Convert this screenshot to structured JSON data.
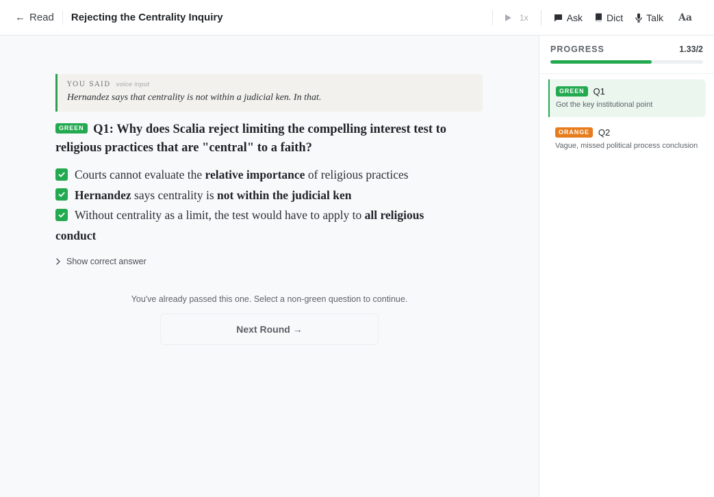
{
  "header": {
    "back_label": "Read",
    "title": "Rejecting the Centrality Inquiry",
    "speed_label": "1x",
    "tools": {
      "ask": "Ask",
      "dict": "Dict",
      "talk": "Talk",
      "font": "Aa"
    }
  },
  "transcript": {
    "label": "YOU SAID",
    "tag": "voice input",
    "text": "Hernandez says that centrality is not within a judicial ken. In that."
  },
  "question": {
    "badge": "GREEN",
    "text": "Q1: Why does Scalia reject limiting the compelling interest test to religious practices that are \"central\" to a faith?"
  },
  "criteria": [
    {
      "pre": "Courts cannot evaluate the ",
      "bold": "relative importance",
      "post": " of religious practices",
      "lead_bold": ""
    },
    {
      "lead_bold": "Hernandez",
      "pre": " says centrality is ",
      "bold": "not within the judicial ken",
      "post": ""
    },
    {
      "lead_bold": "",
      "pre": "Without centrality as a limit, the test would have to apply to ",
      "bold": "all religious conduct",
      "post": ""
    }
  ],
  "show_answer_label": "Show correct answer",
  "passed_message": "You've already passed this one. Select a non-green question to continue.",
  "next_button_label": "Next Round →",
  "sidebar": {
    "progress_label": "PROGRESS",
    "progress_value_text": "1.33/2",
    "progress_fraction": 0.665,
    "questions": [
      {
        "badge": "GREEN",
        "name": "Q1",
        "desc": "Got the key institutional point"
      },
      {
        "badge": "ORANGE",
        "name": "Q2",
        "desc": "Vague, missed political process conclusion"
      }
    ]
  },
  "colors": {
    "green": "#23a94f",
    "orange": "#e67c1d"
  }
}
